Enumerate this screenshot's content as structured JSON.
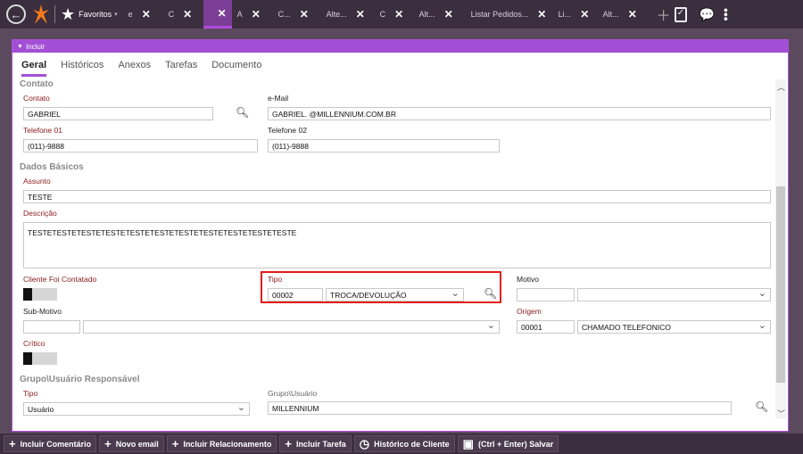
{
  "topbar": {
    "favoritos": "Favoritos",
    "tabs": [
      {
        "label": "e"
      },
      {
        "label": "C"
      },
      {
        "label": ""
      },
      {
        "label": "A"
      },
      {
        "label": "C..."
      },
      {
        "label": "Alte..."
      },
      {
        "label": "C"
      },
      {
        "label": "Alt..."
      },
      {
        "label": "Listar Pedidos..."
      },
      {
        "label": "Li..."
      },
      {
        "label": "Alt..."
      }
    ]
  },
  "panel": {
    "header": "Incluir",
    "subtabs": [
      "Geral",
      "Históricos",
      "Anexos",
      "Tarefas",
      "Documento"
    ]
  },
  "contato": {
    "section": "Contato",
    "contato_label": "Contato",
    "contato_value": "GABRIEL",
    "email_label": "e-Mail",
    "email_value": "GABRIEL.          @MILLENNIUM.COM.BR",
    "tel1_label": "Telefone 01",
    "tel1_value": "(011)-9888",
    "tel2_label": "Telefone 02",
    "tel2_value": "(011)-9888"
  },
  "basicos": {
    "section": "Dados Básicos",
    "assunto_label": "Assunto",
    "assunto_value": "TESTE",
    "descricao_label": "Descrição",
    "descricao_value": "TESTETESTETESTETESTETESTETESTETESTETESTETESTETESTETESTE",
    "cliente_contatado_label": "Cliente Foi Contatado",
    "tipo_label": "Tipo",
    "tipo_code": "00002",
    "tipo_value": "TROCA/DEVOLUÇÃO",
    "motivo_label": "Motivo",
    "submotivo_label": "Sub-Motivo",
    "origem_label": "Origem",
    "origem_code": "00001",
    "origem_value": "CHAMADO TELEFONICO",
    "critico_label": "Crítico"
  },
  "grupo": {
    "section": "Grupo\\Usuário Responsável",
    "tipo_label": "Tipo",
    "tipo_value": "Usuário",
    "grupo_label": "Grupo\\Usuário",
    "grupo_value": "MILLENNIUM"
  },
  "bottombar": {
    "incluir_comentario": "Incluir Comentário",
    "novo_email": "Novo email",
    "incluir_relacionamento": "Incluir Relacionamento",
    "incluir_tarefa": "Incluir Tarefa",
    "historico_cliente": "Histórico de Cliente",
    "salvar": "(Ctrl + Enter) Salvar"
  }
}
